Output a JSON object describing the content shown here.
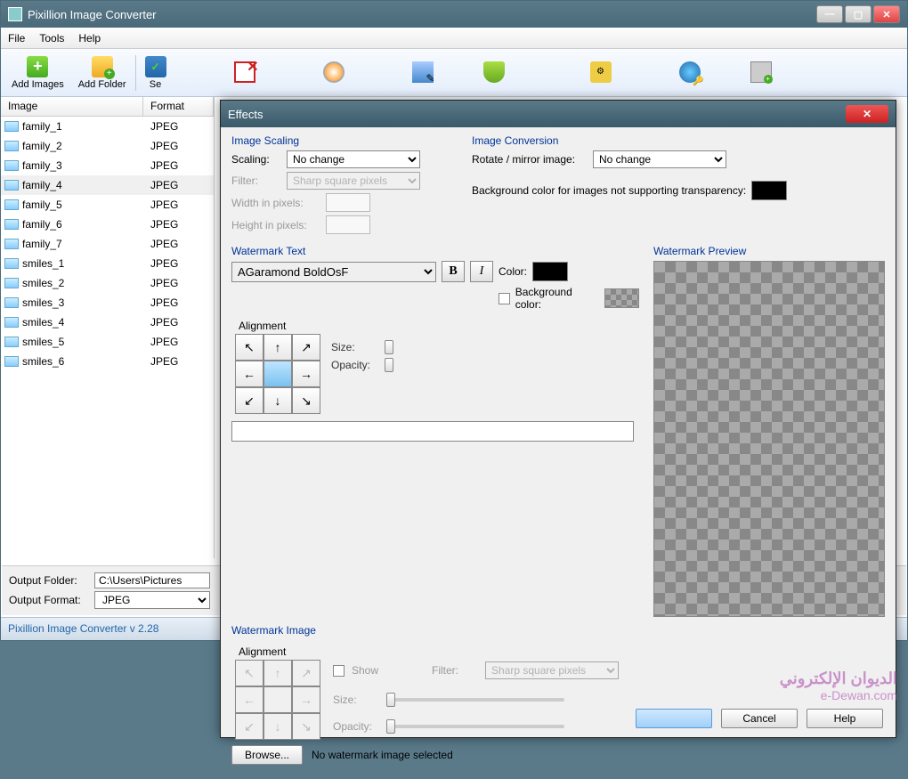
{
  "main": {
    "title": "Pixillion Image Converter",
    "menubar": [
      "File",
      "Tools",
      "Help"
    ],
    "toolbar": [
      {
        "label": "Add Images",
        "icon": "plus"
      },
      {
        "label": "Add Folder",
        "icon": "folder"
      },
      {
        "label": "Se",
        "icon": "sel"
      }
    ],
    "columns": {
      "image": "Image",
      "format": "Format"
    },
    "files": [
      {
        "name": "family_1",
        "format": "JPEG"
      },
      {
        "name": "family_2",
        "format": "JPEG"
      },
      {
        "name": "family_3",
        "format": "JPEG"
      },
      {
        "name": "family_4",
        "format": "JPEG",
        "selected": true
      },
      {
        "name": "family_5",
        "format": "JPEG"
      },
      {
        "name": "family_6",
        "format": "JPEG"
      },
      {
        "name": "family_7",
        "format": "JPEG"
      },
      {
        "name": "smiles_1",
        "format": "JPEG"
      },
      {
        "name": "smiles_2",
        "format": "JPEG"
      },
      {
        "name": "smiles_3",
        "format": "JPEG"
      },
      {
        "name": "smiles_4",
        "format": "JPEG"
      },
      {
        "name": "smiles_5",
        "format": "JPEG"
      },
      {
        "name": "smiles_6",
        "format": "JPEG"
      }
    ],
    "output_folder_label": "Output Folder:",
    "output_folder": "C:\\Users\\Pictures",
    "output_format_label": "Output Format:",
    "output_format": "JPEG",
    "status": "Pixillion Image Converter v 2.28"
  },
  "dialog": {
    "title": "Effects",
    "scaling": {
      "heading": "Image Scaling",
      "scaling_label": "Scaling:",
      "scaling_value": "No change",
      "filter_label": "Filter:",
      "filter_value": "Sharp square pixels",
      "width_label": "Width in pixels:",
      "height_label": "Height in pixels:"
    },
    "conversion": {
      "heading": "Image Conversion",
      "rotate_label": "Rotate / mirror image:",
      "rotate_value": "No change",
      "bg_label": "Background color for images not supporting transparency:"
    },
    "wm_text": {
      "heading": "Watermark Text",
      "font": "AGaramond BoldOsF",
      "color_label": "Color:",
      "bgcolor_label": "Background color:",
      "alignment_label": "Alignment",
      "size_label": "Size:",
      "opacity_label": "Opacity:",
      "arrows": [
        "↖",
        "↑",
        "↗",
        "←",
        "",
        "→",
        "↙",
        "↓",
        "↘"
      ]
    },
    "preview_label": "Watermark Preview",
    "wm_image": {
      "heading": "Watermark Image",
      "alignment_label": "Alignment",
      "show_label": "Show",
      "filter_label": "Filter:",
      "filter_value": "Sharp square pixels",
      "size_label": "Size:",
      "opacity_label": "Opacity:",
      "browse": "Browse...",
      "none": "No watermark image selected"
    },
    "buttons": {
      "cancel": "Cancel",
      "help": "Help"
    }
  },
  "overlay": {
    "line1": "الديوان الإلكتروني",
    "line2": "e-Dewan.com"
  }
}
